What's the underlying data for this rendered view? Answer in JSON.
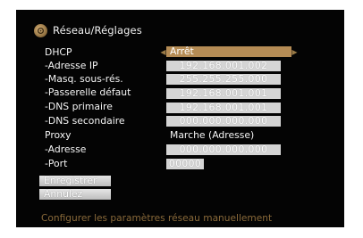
{
  "header": {
    "title": "Réseau/Réglages",
    "icon": "settings-gear-icon"
  },
  "rows": [
    {
      "label": "DHCP",
      "value": "Arrêt"
    },
    {
      "label": "-Adresse IP",
      "value": "192.168.001.002"
    },
    {
      "label": "-Masq. sous-rés.",
      "value": "255.255.255.000"
    },
    {
      "label": "-Passerelle défaut",
      "value": "192.168.001.001"
    },
    {
      "label": "-DNS primaire",
      "value": "192.168.001.001"
    },
    {
      "label": "-DNS secondaire",
      "value": "000.000.000.000"
    },
    {
      "label": "Proxy",
      "value": "Marche (Adresse)"
    },
    {
      "label": "-Adresse",
      "value": "000.000.000.000"
    },
    {
      "label": "-Port",
      "value": "00000"
    }
  ],
  "buttons": {
    "save": "Enregistrer",
    "cancel": "Annulez"
  },
  "hint": "Configurer les paramètres réseau manuellement",
  "colors": {
    "background": "#040404",
    "accent": "#b58c55",
    "field": "#d5d5d5",
    "hint": "#8a6a3a"
  }
}
